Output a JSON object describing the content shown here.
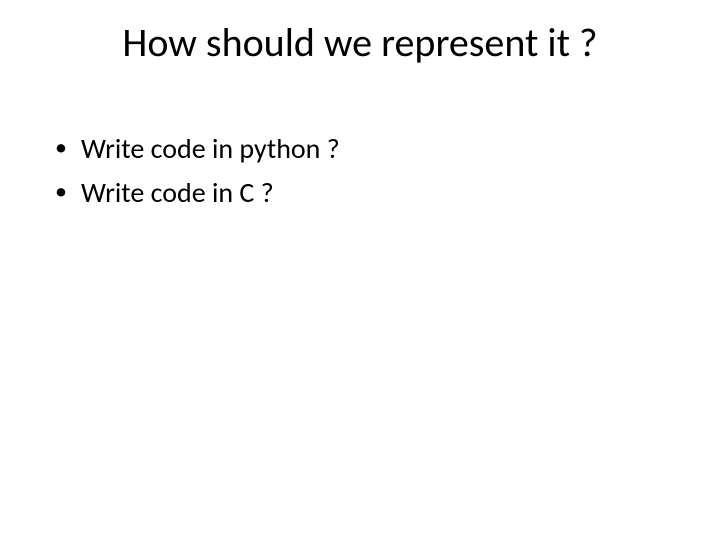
{
  "title": "How should we represent it ?",
  "bullets": [
    "Write code in python ?",
    "Write code in C ?"
  ]
}
